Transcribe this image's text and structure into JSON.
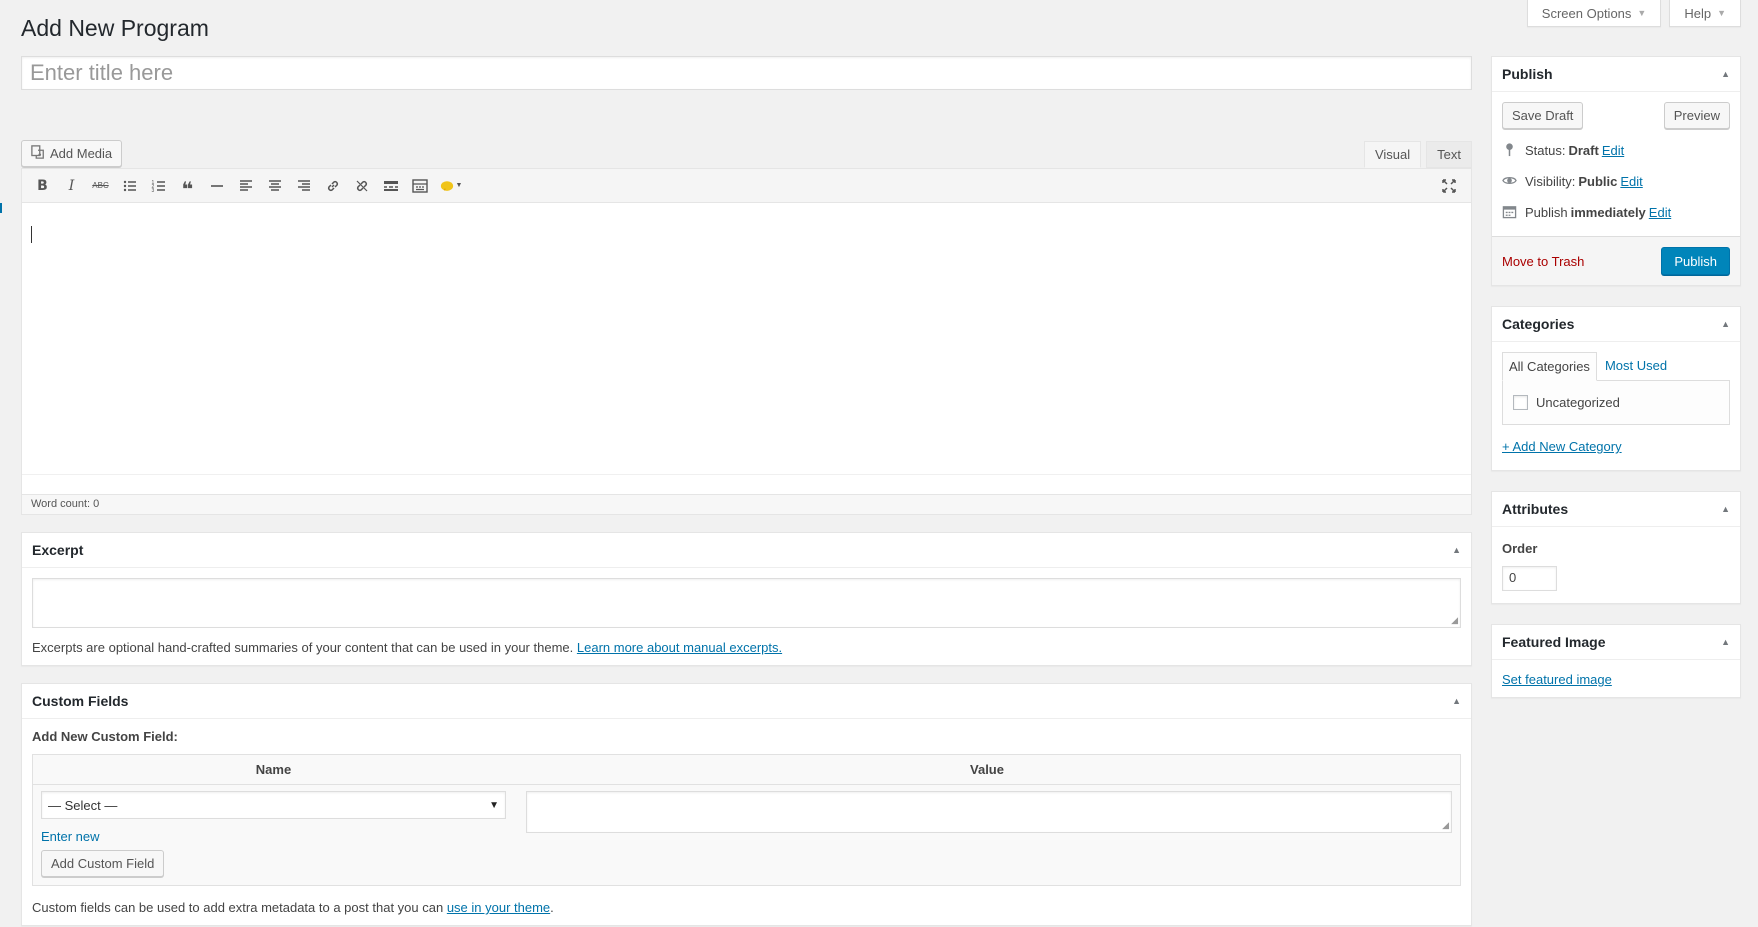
{
  "screen_meta": {
    "screen_options": "Screen Options",
    "help": "Help"
  },
  "page": {
    "title": "Add New Program"
  },
  "title_field": {
    "placeholder": "Enter title here"
  },
  "editor": {
    "add_media": "Add Media",
    "tabs": [
      "Visual",
      "Text"
    ],
    "toolbar_icons": [
      "bold-icon",
      "italic-icon",
      "strikethrough-icon",
      "bullet-list-icon",
      "numbered-list-icon",
      "blockquote-icon",
      "horizontal-rule-icon",
      "align-left-icon",
      "align-center-icon",
      "align-right-icon",
      "link-icon",
      "unlink-icon",
      "read-more-icon",
      "toolbar-toggle-icon",
      "emoji-icon",
      "fullscreen-icon"
    ],
    "word_count": "Word count: 0"
  },
  "excerpt": {
    "title": "Excerpt",
    "help_text": "Excerpts are optional hand-crafted summaries of your content that can be used in your theme.",
    "help_link": "Learn more about manual excerpts."
  },
  "custom_fields": {
    "title": "Custom Fields",
    "subtitle": "Add New Custom Field:",
    "col_name": "Name",
    "col_value": "Value",
    "select_value": "— Select —",
    "enter_new": "Enter new",
    "add_button": "Add Custom Field",
    "help_text": "Custom fields can be used to add extra metadata to a post that you can",
    "help_link": "use in your theme",
    "help_end": "."
  },
  "publish": {
    "title": "Publish",
    "save_draft": "Save Draft",
    "preview": "Preview",
    "status_label": "Status:",
    "status_value": "Draft",
    "visibility_label": "Visibility:",
    "visibility_value": "Public",
    "schedule_label": "Publish",
    "schedule_value": "immediately",
    "edit": "Edit",
    "trash": "Move to Trash",
    "publish_button": "Publish",
    "accent": "#0085ba"
  },
  "categories": {
    "title": "Categories",
    "tab_all": "All Categories",
    "tab_most_used": "Most Used",
    "items": [
      "Uncategorized"
    ],
    "add_new": "+ Add New Category"
  },
  "attributes": {
    "title": "Attributes",
    "order_label": "Order",
    "order_value": "0"
  },
  "featured_image": {
    "title": "Featured Image",
    "set_link": "Set featured image"
  }
}
